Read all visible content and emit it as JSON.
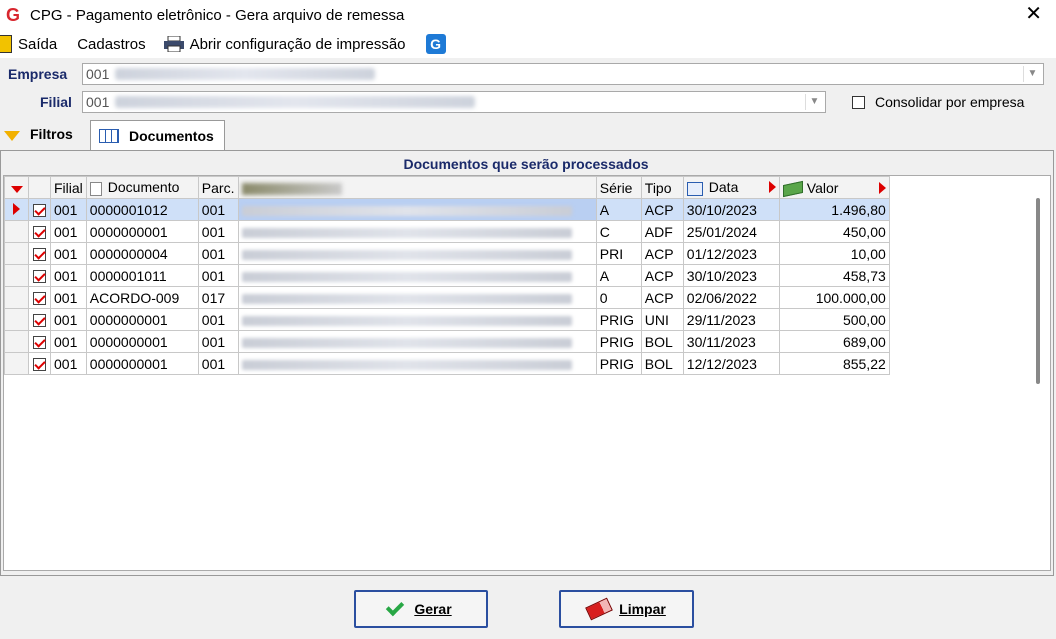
{
  "window": {
    "title": "CPG -  Pagamento eletrônico - Gera arquivo de remessa",
    "close_glyph": "✕",
    "logo_glyph": "G"
  },
  "menu": {
    "items": [
      "Saída",
      "Cadastros",
      "Abrir configuração de impressão"
    ],
    "g_icon_glyph": "G"
  },
  "form": {
    "empresa_label": "Empresa",
    "empresa_value": "001",
    "filial_label": "Filial",
    "filial_value": "001",
    "consolidar_label": "Consolidar por empresa",
    "consolidar_checked": false,
    "dropdown_glyph": "▼"
  },
  "tabs": [
    {
      "label": "Filtros",
      "active": false
    },
    {
      "label": "Documentos",
      "active": true
    }
  ],
  "panel": {
    "title": "Documentos que serão processados"
  },
  "table": {
    "headers": {
      "filial": "Filial",
      "documento": "Documento",
      "parc": "Parc.",
      "serie": "Série",
      "tipo": "Tipo",
      "data": "Data",
      "valor": "Valor"
    },
    "rows": [
      {
        "checked": true,
        "selected": true,
        "filial": "001",
        "documento": "0000001012",
        "parc": "001",
        "serie": "A",
        "tipo": "ACP",
        "data": "30/10/2023",
        "valor": "1.496,80"
      },
      {
        "checked": true,
        "selected": false,
        "filial": "001",
        "documento": "0000000001",
        "parc": "001",
        "serie": "C",
        "tipo": "ADF",
        "data": "25/01/2024",
        "valor": "450,00"
      },
      {
        "checked": true,
        "selected": false,
        "filial": "001",
        "documento": "0000000004",
        "parc": "001",
        "serie": "PRI",
        "tipo": "ACP",
        "data": "01/12/2023",
        "valor": "10,00"
      },
      {
        "checked": true,
        "selected": false,
        "filial": "001",
        "documento": "0000001011",
        "parc": "001",
        "serie": "A",
        "tipo": "ACP",
        "data": "30/10/2023",
        "valor": "458,73"
      },
      {
        "checked": true,
        "selected": false,
        "filial": "001",
        "documento": "ACORDO-009",
        "parc": "017",
        "serie": "0",
        "tipo": "ACP",
        "data": "02/06/2022",
        "valor": "100.000,00"
      },
      {
        "checked": true,
        "selected": false,
        "filial": "001",
        "documento": "0000000001",
        "parc": "001",
        "serie": "PRIG",
        "tipo": "UNI",
        "data": "29/11/2023",
        "valor": "500,00"
      },
      {
        "checked": true,
        "selected": false,
        "filial": "001",
        "documento": "0000000001",
        "parc": "001",
        "serie": "PRIG",
        "tipo": "BOL",
        "data": "30/11/2023",
        "valor": "689,00"
      },
      {
        "checked": true,
        "selected": false,
        "filial": "001",
        "documento": "0000000001",
        "parc": "001",
        "serie": "PRIG",
        "tipo": "BOL",
        "data": "12/12/2023",
        "valor": "855,22"
      }
    ]
  },
  "buttons": {
    "gerar": "Gerar",
    "limpar": "Limpar"
  },
  "colors": {
    "accent_label": "#1a2a6a",
    "selected_row": "#cfe0f8",
    "button_border": "#2b4fa0",
    "marker_red": "#dd0000"
  }
}
